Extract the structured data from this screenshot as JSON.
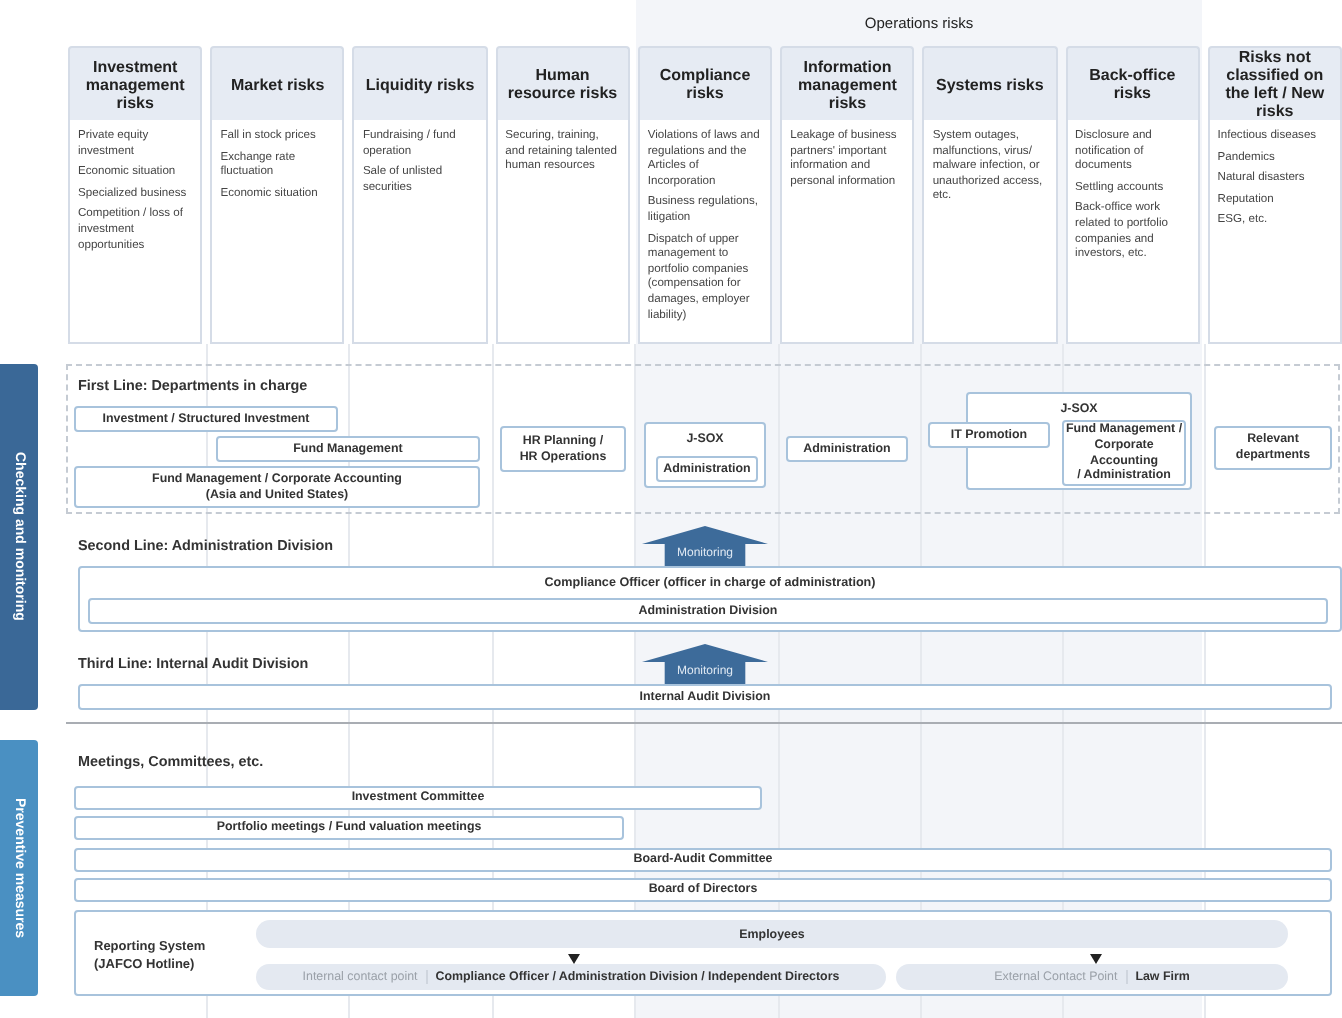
{
  "operations": {
    "label": "Operations risks"
  },
  "risk_categories": [
    {
      "title": "Investment management risks",
      "items": [
        "Private equity investment",
        "Economic situation",
        "Specialized business",
        "Competition / loss of investment opportunities"
      ]
    },
    {
      "title": "Market risks",
      "items": [
        "Fall in stock prices",
        "Exchange rate fluctuation",
        "Economic situation"
      ]
    },
    {
      "title": "Liquidity risks",
      "items": [
        "Fundraising / fund operation",
        "Sale of unlisted securities"
      ]
    },
    {
      "title": "Human resource risks",
      "items": [
        "Securing, training, and retaining talented human resources"
      ]
    },
    {
      "title": "Compliance risks",
      "items": [
        "Violations of laws and regulations and the Articles  of Incorporation",
        "Business regulations, litigation",
        "Dispatch of upper management to portfolio companies (compensation for damages, employer liability)"
      ]
    },
    {
      "title": "Information management risks",
      "items": [
        "Leakage of business partners' important information and personal information"
      ]
    },
    {
      "title": "Systems risks",
      "items": [
        "System outages, malfunctions, virus/ malware infection, or unauthorized access, etc."
      ]
    },
    {
      "title": "Back-office  risks",
      "items": [
        "Disclosure and notification of documents",
        "Settling accounts",
        "Back-office work related to portfolio companies and investors, etc."
      ]
    },
    {
      "title": "Risks not classified on the left / New risks",
      "items": [
        "Infectious diseases",
        "Pandemics",
        "Natural disasters",
        "Reputation",
        "ESG, etc."
      ]
    }
  ],
  "checking_and_monitoring": {
    "label": "Checking and monitoring",
    "first_line": {
      "title": "First Line: Departments in charge",
      "departments": [
        {
          "kind": "box",
          "label": "Investment / Structured Investment"
        },
        {
          "kind": "box",
          "label": "Fund Management"
        },
        {
          "kind": "box",
          "label": "Fund Management / Corporate Accounting\n(Asia and United States)"
        },
        {
          "kind": "box",
          "label": "HR Planning /\nHR Operations"
        },
        {
          "kind": "group",
          "label": "J-SOX",
          "children": [
            "Administration"
          ]
        },
        {
          "kind": "box",
          "label": "Administration"
        },
        {
          "kind": "box",
          "label": "IT Promotion"
        },
        {
          "kind": "group",
          "label": "J-SOX",
          "children": [
            "Fund Management /\nCorporate Accounting\n/ Administration"
          ]
        },
        {
          "kind": "box",
          "label": "Relevant\ndepartments"
        }
      ]
    },
    "second_line": {
      "title": "Second Line: Administration Division",
      "monitoring": "Monitoring",
      "officer": "Compliance Officer (officer in charge of administration)",
      "division": "Administration Division"
    },
    "third_line": {
      "title": "Third Line: Internal Audit Division",
      "monitoring": "Monitoring",
      "division": "Internal Audit Division"
    }
  },
  "preventive_measures": {
    "label": "Preventive measures",
    "title": "Meetings, Committees, etc.",
    "meetings": [
      "Investment Committee",
      "Portfolio meetings / Fund valuation meetings",
      "Board-Audit Committee",
      "Board of Directors"
    ],
    "reporting_system": {
      "label": "Reporting System\n(JAFCO Hotline)",
      "employees": "Employees",
      "contacts": [
        {
          "label": "Internal contact point",
          "value": "Compliance Officer / Administration Division / Independent Directors"
        },
        {
          "label": "External Contact Point",
          "value": "Law Firm"
        }
      ]
    }
  }
}
